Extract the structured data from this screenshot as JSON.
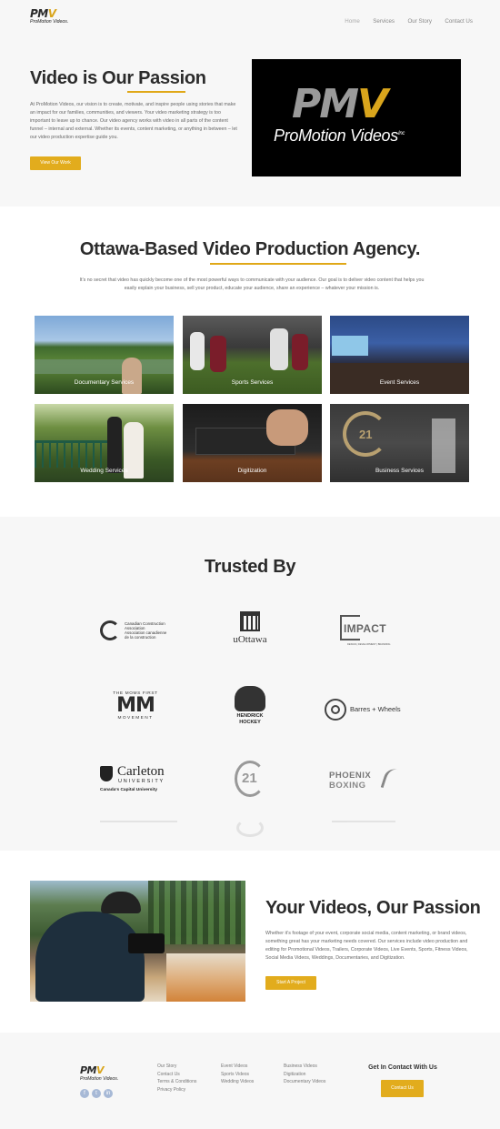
{
  "header": {
    "logo_mark_pm": "PM",
    "logo_mark_v": "V",
    "logo_sub": "ProMotion Videos.",
    "nav": [
      "Home",
      "Services",
      "Our Story",
      "Contact Us"
    ]
  },
  "hero": {
    "title": "Video is Our Passion",
    "body": "At ProMotion Videos, our vision is to create, motivate, and inspire people using stories that make an impact for our families, communities, and viewers. Your video marketing strategy is too important to leave up to chance. Our video agency works with video in all parts of the content funnel – internal and external. Whether its events, content marketing, or anything in between – let our video production expertise guide you.",
    "button": "View Our Work",
    "image_logo_pm": "PM",
    "image_logo_v": "V",
    "image_logo_sub": "ProMotion Videos",
    "image_logo_inc": "Inc"
  },
  "agency": {
    "title": "Ottawa-Based Video Production Agency.",
    "body": "It’s no secret that video has quickly become one of the most powerful ways to communicate with your audience. Our goal is to deliver video content that helps you easily explain your business, sell your product, educate your audience, share an experience – whatever your mission is.",
    "tiles": [
      {
        "label": "Documentary Services"
      },
      {
        "label": "Sports Services"
      },
      {
        "label": "Event Services"
      },
      {
        "label": "Wedding Services"
      },
      {
        "label": "Digitization"
      },
      {
        "label": "Business Services"
      }
    ]
  },
  "trusted": {
    "title": "Trusted By",
    "logos": {
      "cca_line1": "Canadian Construction",
      "cca_line2": "Association",
      "cca_line3": "Association canadienne",
      "cca_line4": "de la construction",
      "uottawa": "uOttawa",
      "impact": "IMPACT",
      "impact_sub": "DESIGN | DEVELOPMENT | BRANDING",
      "moms_top": "THE MOMS FIRST",
      "moms_mid": "MM",
      "moms_bottom": "MOVEMENT",
      "hockey": "HENDRICK HOCKEY",
      "barres": "Barres + Wheels",
      "carleton": "Carleton",
      "carleton_u": "UNIVERSITY",
      "carleton_tag": "Canada's Capital University",
      "c21": "21",
      "phoenix": "PHOENIX",
      "phoenix_sub": "BOXING"
    }
  },
  "passion": {
    "title": "Your Videos, Our Passion",
    "body": "Whether it’s footage of your event, corporate social media, content marketing, or brand videos, something great has your marketing needs covered. Our services include video production and editing for Promotional Videos, Trailers, Corporate Videos, Live Events, Sports, Fitness Videos, Social Media Videos, Weddings, Documentaries, and Digitization.",
    "button": "Start A Project"
  },
  "footer": {
    "logo_mark_pm": "PM",
    "logo_mark_v": "V",
    "logo_sub": "ProMotion Videos.",
    "col1": [
      "Our Story",
      "Contact Us",
      "Terms & Conditions",
      "Privacy Policy"
    ],
    "col2": [
      "Event Videos",
      "Sports Videos",
      "Wedding Videos"
    ],
    "col3": [
      "Business Videos",
      "Digitization",
      "Documentary Videos"
    ],
    "contact_heading": "Get In Contact With Us",
    "contact_button": "Contact Us",
    "social": [
      "f",
      "t",
      "in"
    ]
  },
  "colors": {
    "accent": "#e2ac1d",
    "heading": "#2b2b2b",
    "body_text": "#666666"
  }
}
